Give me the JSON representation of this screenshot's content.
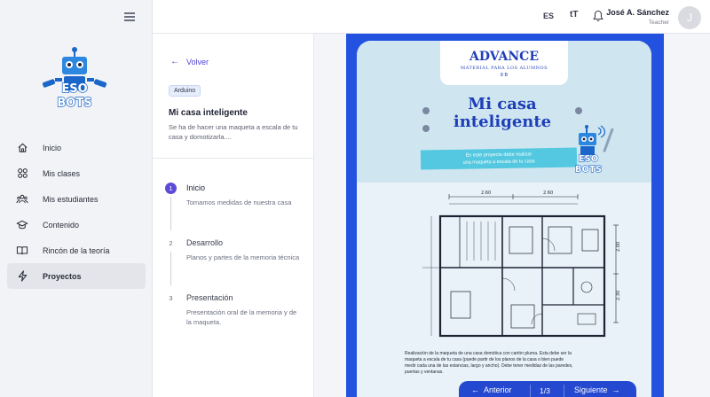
{
  "sidebar": {
    "logo_text": "ESO BOTS",
    "items": [
      {
        "label": "Inicio",
        "icon": "home-icon"
      },
      {
        "label": "Mis clases",
        "icon": "grid-icon"
      },
      {
        "label": "Mis estudiantes",
        "icon": "users-icon"
      },
      {
        "label": "Contenido",
        "icon": "graduation-cap-icon"
      },
      {
        "label": "Rincón de la teoría",
        "icon": "book-icon"
      },
      {
        "label": "Proyectos",
        "icon": "bolt-icon"
      }
    ]
  },
  "topbar": {
    "language": "ES",
    "text_size_icon": "tT",
    "user_name": "José A. Sánchez",
    "user_role": "Teacher",
    "avatar_initial": "J"
  },
  "panel": {
    "back_label": "Volver",
    "tag": "Arduino",
    "title": "Mi casa inteligente",
    "description": "Se ha de hacer una maqueta a escala de tu casa y domotizarla....",
    "steps": [
      {
        "num": "1",
        "title": "Inicio",
        "desc": "Tomamos medidas de nuestra casa"
      },
      {
        "num": "2",
        "title": "Desarrollo",
        "desc": "Planos y partes de la memoria técnica"
      },
      {
        "num": "3",
        "title": "Presentación",
        "desc": "Presentación oral de la memoria y de la maqueta."
      }
    ]
  },
  "document": {
    "header": "ADVANCE",
    "header_sub": "MATERIAL PARA LOS ALUMNOS",
    "header_num": "8 B",
    "title_line1": "Mi casa",
    "title_line2": "inteligente",
    "banner_line1": "En este proyecto debe realizar",
    "banner_line2": "una maqueta a escala de tu casa",
    "robot_text": "ESO BOTS",
    "dims": {
      "top_left": "2.60",
      "top_right": "2.60",
      "right_top": "2.00",
      "right_bottom": "2.30"
    },
    "caption": "Realización de la maqueta de una casa domótica con cartón pluma. Esta debe ser la maqueta a escala de tu casa (puede partir de los planos de la casa o bien puede medir cada una de las estancias, largo y ancho). Debe tener medidas de las paredes, puertas y ventanas."
  },
  "pager": {
    "prev_label": "Anterior",
    "next_label": "Siguiente",
    "page": "1/3"
  },
  "colors": {
    "accent": "#5b4bd8",
    "doc_blue": "#2352e0",
    "title_blue": "#1f3fb8",
    "banner_cyan": "#53c8e0"
  }
}
